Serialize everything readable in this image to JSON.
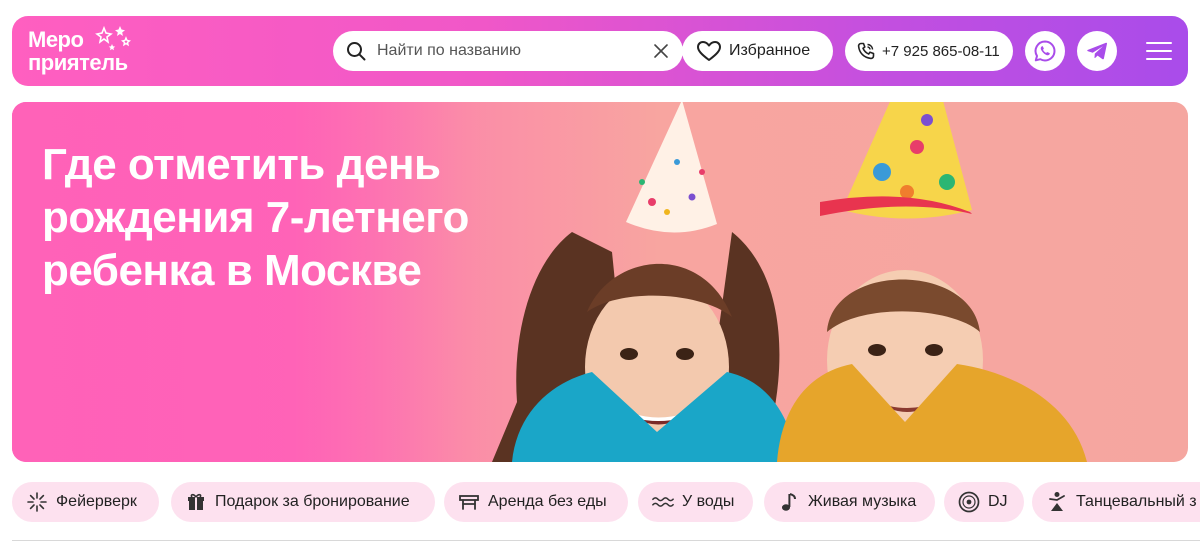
{
  "header": {
    "logo_line1": "Меро",
    "logo_line2": "приятель",
    "search_placeholder": "Найти по названию",
    "favorites_label": "Избранное",
    "phone": "+7 925 865-08-11",
    "colors": {
      "gradient_start": "#ff5fc0",
      "gradient_end": "#a94cea"
    }
  },
  "hero": {
    "title": "Где отметить день рождения 7-летнего ребенка в Москве"
  },
  "chips": [
    {
      "label": "Фейерверк",
      "icon": "firework-icon"
    },
    {
      "label": "Подарок за бронирование",
      "icon": "gift-icon"
    },
    {
      "label": "Аренда без еды",
      "icon": "table-icon"
    },
    {
      "label": "У воды",
      "icon": "water-icon"
    },
    {
      "label": "Живая музыка",
      "icon": "music-note-icon"
    },
    {
      "label": "DJ",
      "icon": "vinyl-icon"
    },
    {
      "label": "Танцевальный з",
      "icon": "dancer-icon"
    }
  ]
}
